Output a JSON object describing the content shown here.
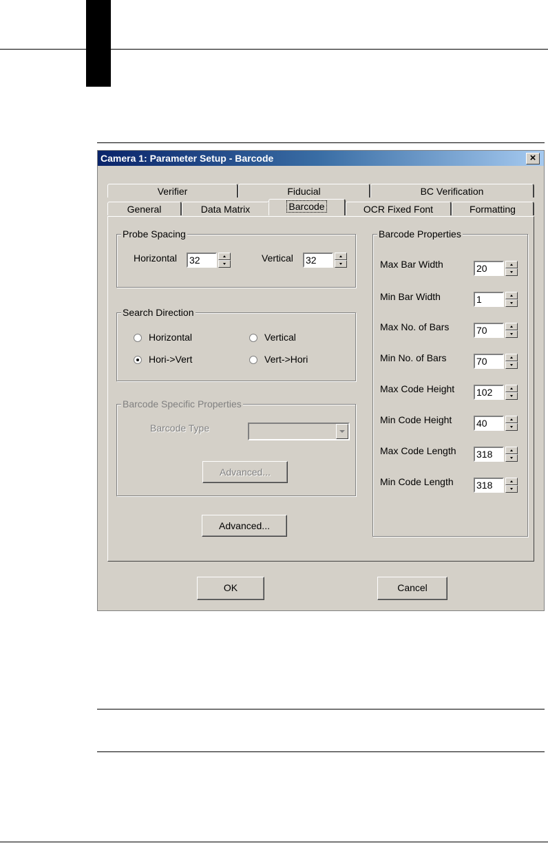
{
  "dialog": {
    "title": "Camera 1: Parameter Setup - Barcode",
    "close_icon": "close-icon",
    "tabs_row1": [
      "Verifier",
      "Fiducial",
      "BC Verification"
    ],
    "tabs_row2": [
      "General",
      "Data Matrix",
      "Barcode",
      "OCR Fixed Font",
      "Formatting"
    ],
    "selected_tab": "Barcode"
  },
  "probe_spacing": {
    "title": "Probe Spacing",
    "horizontal_label": "Horizontal",
    "horizontal_value": "32",
    "vertical_label": "Vertical",
    "vertical_value": "32"
  },
  "search_direction": {
    "title": "Search Direction",
    "options": [
      "Horizontal",
      "Vertical",
      "Hori->Vert",
      "Vert->Hori"
    ],
    "selected": "Hori->Vert"
  },
  "barcode_specific": {
    "title": "Barcode Specific Properties",
    "type_label": "Barcode Type",
    "type_value": "",
    "advanced_label": "Advanced..."
  },
  "advanced_button": "Advanced...",
  "barcode_properties": {
    "title": "Barcode Properties",
    "fields": [
      {
        "label": "Max Bar Width",
        "value": "20"
      },
      {
        "label": "Min Bar Width",
        "value": "1"
      },
      {
        "label": "Max No. of Bars",
        "value": "70"
      },
      {
        "label": "Min No. of Bars",
        "value": "70"
      },
      {
        "label": "Max Code Height",
        "value": "102"
      },
      {
        "label": "Min Code Height",
        "value": "40"
      },
      {
        "label": "Max Code Length",
        "value": "318"
      },
      {
        "label": "Min Code Length",
        "value": "318"
      }
    ]
  },
  "footer": {
    "ok_label": "OK",
    "cancel_label": "Cancel"
  }
}
